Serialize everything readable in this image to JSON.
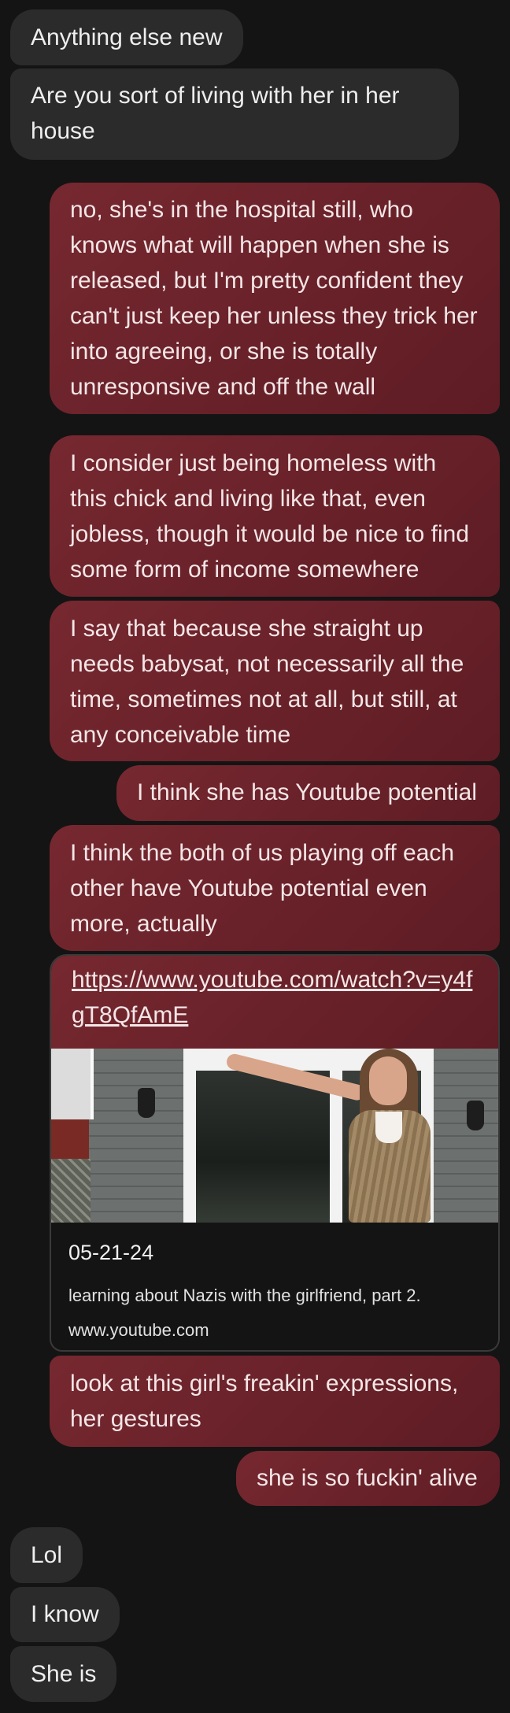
{
  "messages": [
    {
      "direction": "incoming",
      "text": "Anything else new"
    },
    {
      "direction": "incoming",
      "text": "Are you sort of living with her in her house"
    },
    {
      "direction": "outgoing",
      "text": "no, she's in the hospital still, who knows what will happen when she is released, but I'm pretty confident they can't just keep her unless they trick her into agreeing, or she is totally unresponsive and off the wall"
    },
    {
      "direction": "outgoing",
      "text": "I consider just being homeless with this chick and living like that, even jobless, though it would be nice to find some form of income somewhere"
    },
    {
      "direction": "outgoing",
      "text": "I say that because she straight up needs babysat, not necessarily all the time, sometimes not at all, but still, at any conceivable time"
    },
    {
      "direction": "outgoing",
      "text": "I think she has Youtube potential"
    },
    {
      "direction": "outgoing",
      "text": "I think the both of us playing off each other have Youtube potential even more, actually"
    },
    {
      "direction": "outgoing",
      "text": "look at this girl's freakin' expressions, her gestures"
    },
    {
      "direction": "outgoing",
      "text": "she is so fuckin' alive"
    },
    {
      "direction": "incoming",
      "text": "Lol"
    },
    {
      "direction": "incoming",
      "text": "I know"
    },
    {
      "direction": "incoming",
      "text": "She is"
    }
  ],
  "link_preview": {
    "url": "https://www.youtube.com/watch?v=y4fgT8QfAmE",
    "title": "05-21-24",
    "description": "learning about Nazis with the girlfriend, part 2.",
    "domain": "www.youtube.com"
  },
  "colors": {
    "background": "#141414",
    "incoming_bubble": "#2b2b2b",
    "outgoing_bubble": "#6a222a",
    "text": "#ececec"
  }
}
